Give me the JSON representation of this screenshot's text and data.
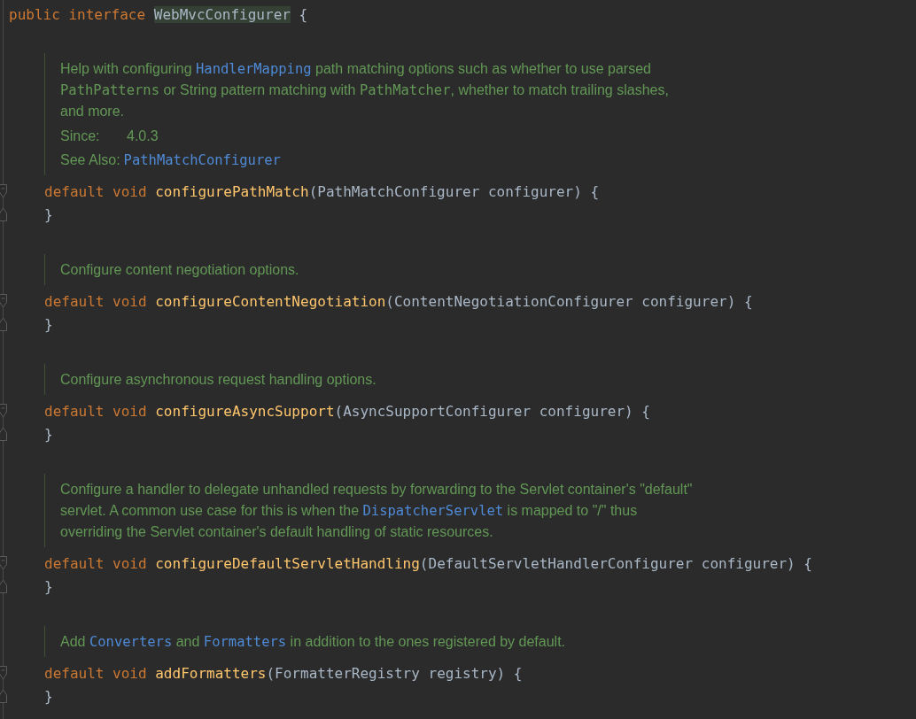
{
  "header": {
    "keywords": "public interface",
    "name": "WebMvcConfigurer",
    "brace": "{"
  },
  "methods": [
    {
      "doc": {
        "lines": [
          [
            {
              "kind": "text",
              "text": "Help with configuring "
            },
            {
              "kind": "link",
              "text": "HandlerMapping"
            },
            {
              "kind": "text",
              "text": " path matching options such as whether to use parsed"
            }
          ],
          [
            {
              "kind": "code",
              "text": "PathPatterns"
            },
            {
              "kind": "text",
              "text": " or String pattern matching with "
            },
            {
              "kind": "code",
              "text": "PathMatcher"
            },
            {
              "kind": "text",
              "text": ", whether to match trailing slashes,"
            }
          ],
          [
            {
              "kind": "text",
              "text": "and more."
            }
          ]
        ],
        "since": {
          "label": "Since:",
          "value": "4.0.3"
        },
        "see_also": {
          "label": "See Also:",
          "link": "PathMatchConfigurer"
        }
      },
      "modifiers": "default void",
      "name": "configurePathMatch",
      "params": "(PathMatchConfigurer configurer) {",
      "close": "}"
    },
    {
      "doc": {
        "lines": [
          [
            {
              "kind": "text",
              "text": "Configure content negotiation options."
            }
          ]
        ]
      },
      "modifiers": "default void",
      "name": "configureContentNegotiation",
      "params": "(ContentNegotiationConfigurer configurer) {",
      "close": "}"
    },
    {
      "doc": {
        "lines": [
          [
            {
              "kind": "text",
              "text": "Configure asynchronous request handling options."
            }
          ]
        ]
      },
      "modifiers": "default void",
      "name": "configureAsyncSupport",
      "params": "(AsyncSupportConfigurer configurer) {",
      "close": "}"
    },
    {
      "doc": {
        "lines": [
          [
            {
              "kind": "text",
              "text": "Configure a handler to delegate unhandled requests by forwarding to the Servlet container's \"default\""
            }
          ],
          [
            {
              "kind": "text",
              "text": "servlet. A common use case for this is when the "
            },
            {
              "kind": "link",
              "text": "DispatcherServlet"
            },
            {
              "kind": "text",
              "text": " is mapped to \"/\" thus"
            }
          ],
          [
            {
              "kind": "text",
              "text": "overriding the Servlet container's default handling of static resources."
            }
          ]
        ]
      },
      "modifiers": "default void",
      "name": "configureDefaultServletHandling",
      "params": "(DefaultServletHandlerConfigurer configurer) {",
      "close": "}"
    },
    {
      "doc": {
        "lines": [
          [
            {
              "kind": "text",
              "text": "Add "
            },
            {
              "kind": "link",
              "text": "Converters"
            },
            {
              "kind": "text",
              "text": " and "
            },
            {
              "kind": "link",
              "text": "Formatters"
            },
            {
              "kind": "text",
              "text": " in addition to the ones registered by default."
            }
          ]
        ]
      },
      "modifiers": "default void",
      "name": "addFormatters",
      "params": "(FormatterRegistry registry) {",
      "close": "}"
    }
  ]
}
